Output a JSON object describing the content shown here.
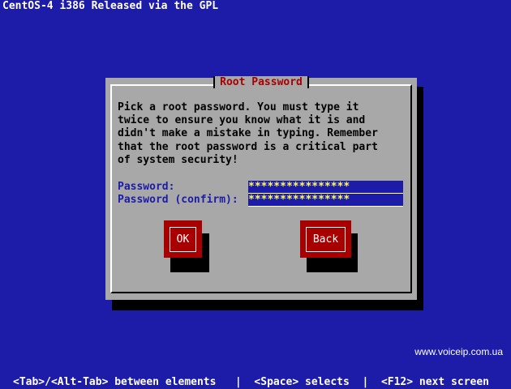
{
  "header": {
    "title": "CentOS-4 i386 Released via the GPL"
  },
  "dialog": {
    "title": "Root Password",
    "instructions": "Pick a root password. You must type it\ntwice to ensure you know what it is and\ndidn't make a mistake in typing. Remember\nthat the root password is a critical part\nof system security!",
    "password_label": "Password:",
    "password_value": "****************",
    "confirm_label": "Password (confirm):",
    "confirm_value": "****************",
    "ok_label": "OK",
    "back_label": "Back"
  },
  "watermark": "www.voiceip.com.ua",
  "footer": {
    "help": "<Tab>/<Alt-Tab> between elements   |  <Space> selects  |  <F12> next screen"
  },
  "colors": {
    "background": "#1c1ca8",
    "dialog": "#a8a8a8",
    "title_text": "#a80000",
    "button": "#a80000",
    "input_text": "#fcfc54"
  }
}
